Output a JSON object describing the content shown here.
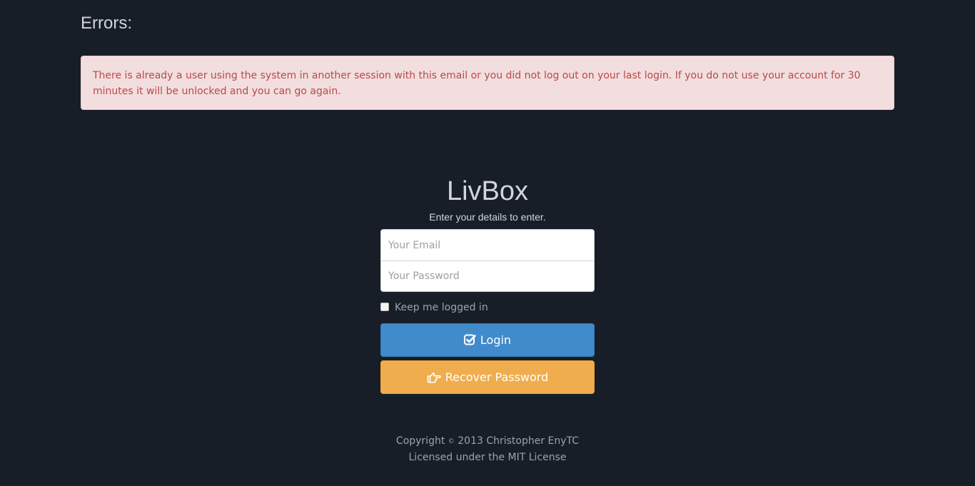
{
  "errors": {
    "heading": "Errors:",
    "message": "There is already a user using the system in another session with this email or you did not log out on your last login. If you do not use your account for 30 minutes it will be unlocked and you can go again."
  },
  "login": {
    "brand": "LivBox",
    "subtitle": "Enter your details to enter.",
    "email_placeholder": "Your Email",
    "password_placeholder": "Your Password",
    "remember_label": "Keep me logged in",
    "login_label": "Login",
    "login_icon": "check-square-icon",
    "recover_label": "Recover Password",
    "recover_icon": "hand-pointer-icon"
  },
  "footer": {
    "copyright_prefix": "Copyright",
    "copyright_symbol": "©",
    "copyright_rest": "2013 Christopher EnyTC",
    "license": "Licensed under the MIT License"
  },
  "colors": {
    "background": "#171e28",
    "alert_bg": "#f2dede",
    "alert_text": "#b94a48",
    "login_button": "#428bca",
    "recover_button": "#f0ad4e"
  }
}
